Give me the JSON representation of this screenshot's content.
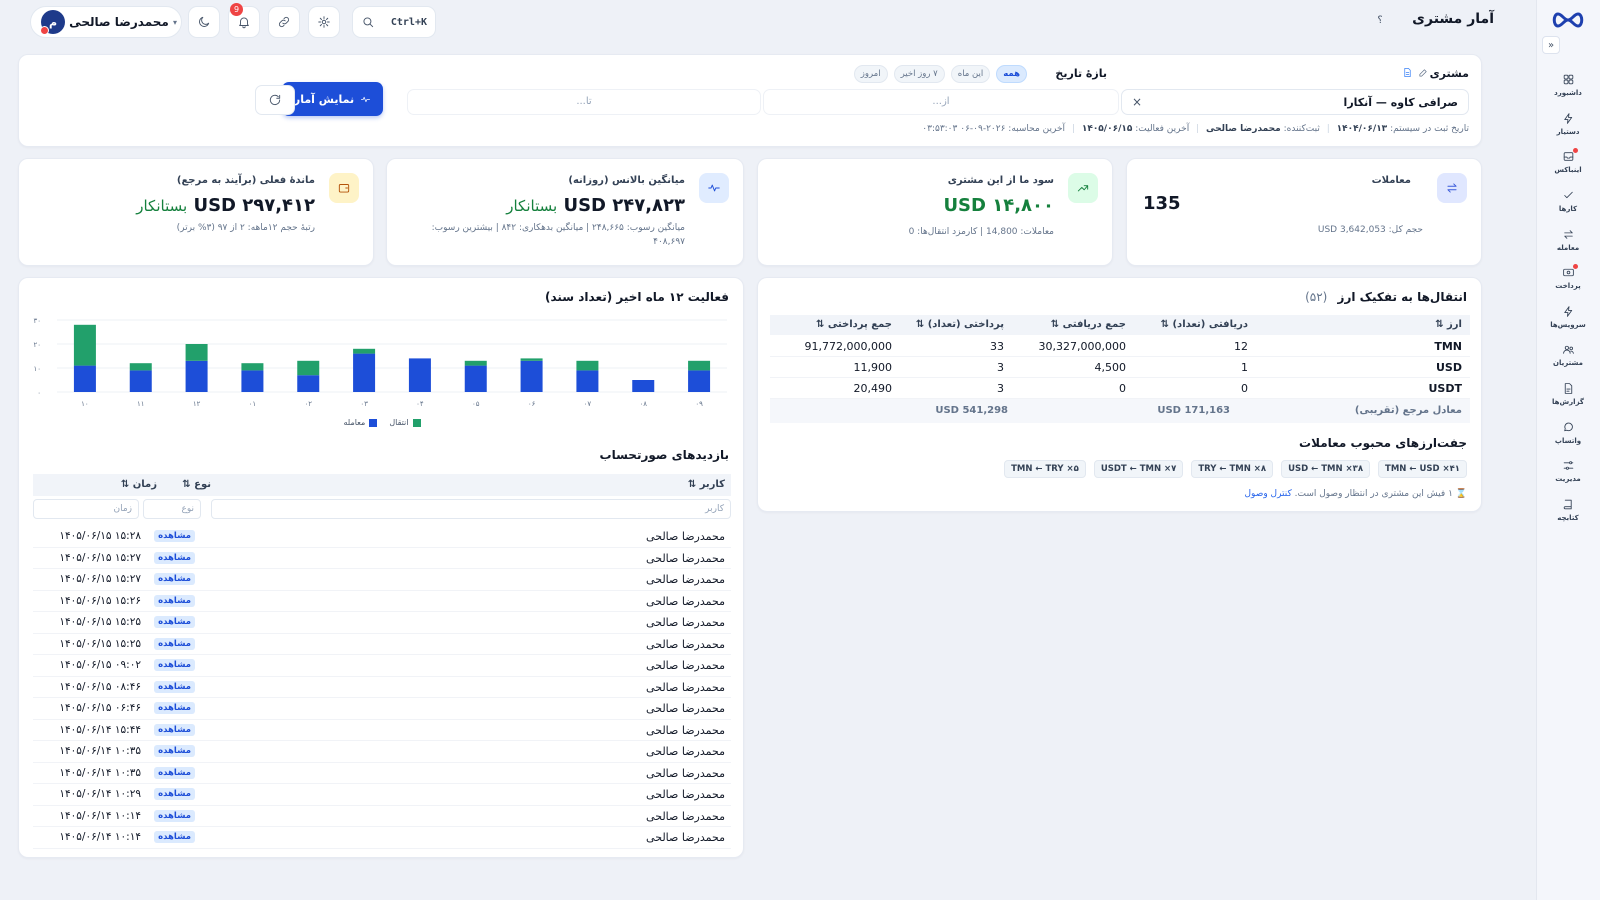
{
  "header": {
    "title": "آمار مشتری",
    "help": "؟",
    "search_shortcut": "Ctrl+K",
    "notifications_count": "9",
    "user": {
      "name": "محمدرضا صالحی",
      "initial": "م"
    }
  },
  "sidebar": {
    "collapse": "«",
    "items": [
      {
        "label": "داشبورد",
        "icon": "grid-icon"
      },
      {
        "label": "دستیار",
        "icon": "bolt-icon"
      },
      {
        "label": "اینباکس",
        "icon": "inbox-icon",
        "dot": true
      },
      {
        "label": "کارها",
        "icon": "check-icon"
      },
      {
        "label": "معامله",
        "icon": "swap-icon"
      },
      {
        "label": "پرداخت",
        "icon": "payment-icon",
        "dot": true
      },
      {
        "label": "سرویس‌ها",
        "icon": "service-icon"
      },
      {
        "label": "مشتریان",
        "icon": "users-icon"
      },
      {
        "label": "گزارش‌ها",
        "icon": "report-icon"
      },
      {
        "label": "واتساپ",
        "icon": "chat-icon"
      },
      {
        "label": "مدیریت",
        "icon": "settings-icon"
      },
      {
        "label": "کتابچه",
        "icon": "book-icon"
      }
    ]
  },
  "filter": {
    "customer_label": "مشتری",
    "customer_value": "صرافی کاوه — آنکارا",
    "clear": "×",
    "range_label": "بازهٔ تاریخ",
    "range_chips": [
      "همه",
      "این ماه",
      "۷ روز اخیر",
      "امروز"
    ],
    "from_placeholder": "از...",
    "to_placeholder": "تا...",
    "show_button": "نمایش آمار",
    "meta": {
      "registered_label": "تاریخ ثبت در سیستم:",
      "registered_value": "۱۴۰۴/۰۶/۱۳",
      "creator_label": "ثبت‌کننده:",
      "creator_value": "محمدرضا صالحی",
      "last_activity_label": "آخرین فعالیت:",
      "last_activity_value": "۱۴۰۵/۰۶/۱۵",
      "last_calc_label": "آخرین محاسبه:",
      "last_calc_value": "۲۰۲۶-۰۹-۰۶ ۰۳:۵۳:۰۳"
    }
  },
  "stats": {
    "trades": {
      "title": "معاملات",
      "value": "135",
      "sub": "حجم کل: 3,642,053 USD"
    },
    "profit": {
      "title": "سود ما از این مشتری",
      "value": "USD ۱۴,۸۰۰",
      "sub": "معاملات: 14,800 | کارمزد انتقال‌ها: 0"
    },
    "avg_balance": {
      "title": "میانگین بالانس (روزانه)",
      "value": "USD ۲۴۷,۸۲۳",
      "status": "بستانکار",
      "line1": "میانگین رسوب: ۲۴۸,۶۶۵ | میانگین بدهکاری: ۸۴۲ | بیشترین رسوب:",
      "min_debt": "۸۴۲",
      "line2": "۴۰۸,۶۹۷"
    },
    "balance": {
      "title": "ماندهٔ فعلی (برآیند به مرجع)",
      "value": "USD ۲۹۷,۴۱۲",
      "status": "بستانکار",
      "sub": "رتبهٔ حجم ۱۲ماهه: ۲ از ۹۷ (۳% برتر)"
    }
  },
  "activity": {
    "title": "فعالیت ۱۲ ماه اخیر (تعداد سند)",
    "legend_trade": "معامله",
    "legend_transfer": "انتقال"
  },
  "chart_data": {
    "type": "bar",
    "stacked": true,
    "categories": [
      "۱۰",
      "۱۱",
      "۱۲",
      "۰۱",
      "۰۲",
      "۰۳",
      "۰۴",
      "۰۵",
      "۰۶",
      "۰۷",
      "۰۸",
      "۰۹"
    ],
    "series": [
      {
        "name": "معامله",
        "color": "#1d4ed8",
        "values": [
          11,
          9,
          13,
          9,
          7,
          16,
          14,
          11,
          13,
          9,
          5,
          9
        ]
      },
      {
        "name": "انتقال",
        "color": "#22a06b",
        "values": [
          17,
          3,
          7,
          3,
          6,
          2,
          0,
          2,
          1,
          4,
          0,
          4
        ]
      }
    ],
    "yticks": [
      "۰",
      "۱۰",
      "۲۰",
      "۳۰"
    ],
    "ylim": [
      0,
      30
    ]
  },
  "visits": {
    "title": "بازدیدهای صورتحساب",
    "col_user": "کاربر ⇅",
    "col_type": "نوع ⇅",
    "col_time": "زمان ⇅",
    "filter_user": "کاربر",
    "filter_type": "نوع",
    "filter_time": "زمان",
    "rows": [
      {
        "user": "محمدرضا صالحی",
        "type": "مشاهده",
        "time": "۱۴۰۵/۰۶/۱۵ ۱۵:۲۸"
      },
      {
        "user": "محمدرضا صالحی",
        "type": "مشاهده",
        "time": "۱۴۰۵/۰۶/۱۵ ۱۵:۲۷"
      },
      {
        "user": "محمدرضا صالحی",
        "type": "مشاهده",
        "time": "۱۴۰۵/۰۶/۱۵ ۱۵:۲۷"
      },
      {
        "user": "محمدرضا صالحی",
        "type": "مشاهده",
        "time": "۱۴۰۵/۰۶/۱۵ ۱۵:۲۶"
      },
      {
        "user": "محمدرضا صالحی",
        "type": "مشاهده",
        "time": "۱۴۰۵/۰۶/۱۵ ۱۵:۲۵"
      },
      {
        "user": "محمدرضا صالحی",
        "type": "مشاهده",
        "time": "۱۴۰۵/۰۶/۱۵ ۱۵:۲۵"
      },
      {
        "user": "محمدرضا صالحی",
        "type": "مشاهده",
        "time": "۱۴۰۵/۰۶/۱۵ ۰۹:۰۲"
      },
      {
        "user": "محمدرضا صالحی",
        "type": "مشاهده",
        "time": "۱۴۰۵/۰۶/۱۵ ۰۸:۴۶"
      },
      {
        "user": "محمدرضا صالحی",
        "type": "مشاهده",
        "time": "۱۴۰۵/۰۶/۱۵ ۰۶:۴۶"
      },
      {
        "user": "محمدرضا صالحی",
        "type": "مشاهده",
        "time": "۱۴۰۵/۰۶/۱۴ ۱۵:۴۴"
      },
      {
        "user": "محمدرضا صالحی",
        "type": "مشاهده",
        "time": "۱۴۰۵/۰۶/۱۴ ۱۰:۳۵"
      },
      {
        "user": "محمدرضا صالحی",
        "type": "مشاهده",
        "time": "۱۴۰۵/۰۶/۱۴ ۱۰:۳۵"
      },
      {
        "user": "محمدرضا صالحی",
        "type": "مشاهده",
        "time": "۱۴۰۵/۰۶/۱۴ ۱۰:۲۹"
      },
      {
        "user": "محمدرضا صالحی",
        "type": "مشاهده",
        "time": "۱۴۰۵/۰۶/۱۴ ۱۰:۱۴"
      },
      {
        "user": "محمدرضا صالحی",
        "type": "مشاهده",
        "time": "۱۴۰۵/۰۶/۱۴ ۱۰:۱۴"
      }
    ]
  },
  "currency": {
    "title": "انتقال‌ها به تفکیک ارز",
    "count": "(۵۲)",
    "headers": [
      "ارز ⇅",
      "دریافتی (تعداد) ⇅",
      "جمع دریافتی ⇅",
      "پرداختی (تعداد) ⇅",
      "جمع پرداختی ⇅"
    ],
    "rows": [
      [
        "TMN",
        "12",
        "30,327,000,000",
        "33",
        "91,772,000,000"
      ],
      [
        "USD",
        "1",
        "4,500",
        "3",
        "11,900"
      ],
      [
        "USDT",
        "0",
        "0",
        "3",
        "20,490"
      ]
    ],
    "total_label": "معادل مرجع (تقریبی)",
    "total_received": "171,163 USD",
    "total_paid": "541,298 USD",
    "pairs_title": "جفت‌ارزهای محبوب معاملات",
    "pairs": [
      "TMN ← USD ×۴۱",
      "USD ← TMN ×۳۸",
      "TRY ← TMN ×۸",
      "USDT ← TMN ×۷",
      "TMN ← TRY ×۵"
    ],
    "receipt_note": "۱ فیش این مشتری در انتظار وصول است.",
    "receipt_link": "کنترل وصول"
  }
}
